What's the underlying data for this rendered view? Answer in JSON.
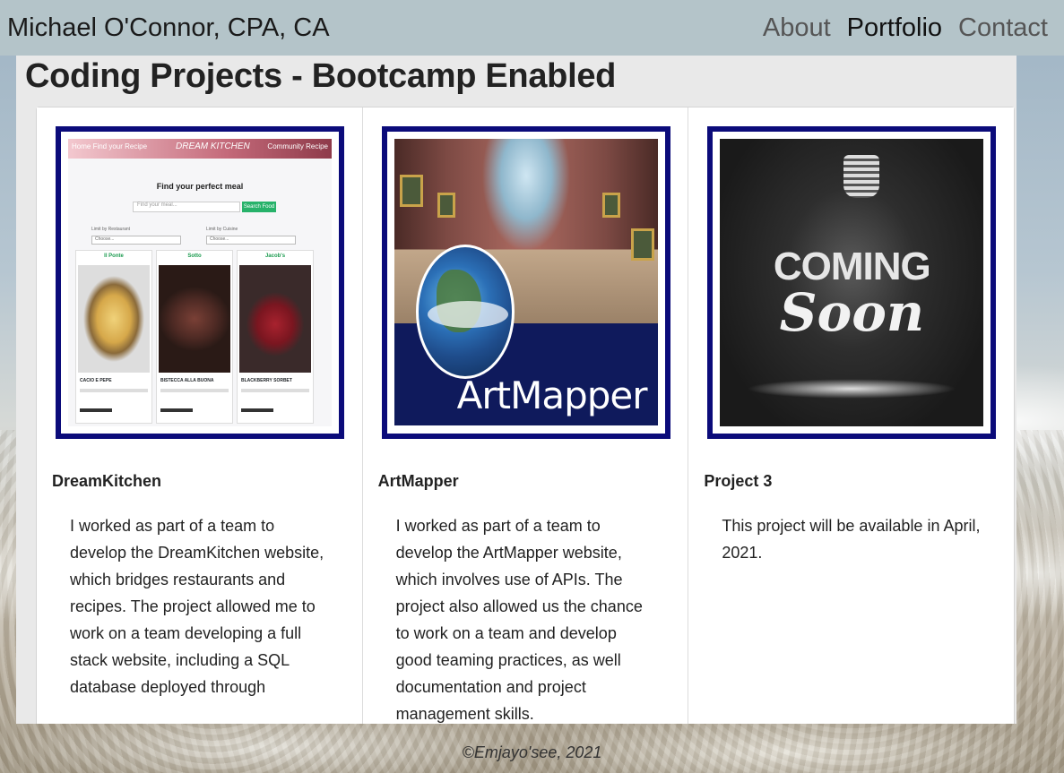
{
  "nav": {
    "brand": "Michael O'Connor, CPA, CA",
    "links": [
      {
        "label": "About",
        "active": false
      },
      {
        "label": "Portfolio",
        "active": true
      },
      {
        "label": "Contact",
        "active": false
      }
    ]
  },
  "page": {
    "title": "Coding Projects - Bootcamp Enabled"
  },
  "projects": [
    {
      "title": "DreamKitchen",
      "text": "I worked as part of a team to develop the DreamKitchen website, which bridges restaurants and recipes. The project allowed me to work on a team developing a full stack website, including a SQL database deployed through",
      "thumbnail": {
        "brand": "DREAM KITCHEN",
        "nav_left": "Home  Find your Recipe",
        "nav_right": "Community Recipe",
        "heading": "Find your perfect meal",
        "search_placeholder": "Find your meal...",
        "search_button": "Search Food",
        "filter_1_label": "Limit by Restaurant",
        "filter_2_label": "Limit by Cuisine",
        "filter_value": "Choose...",
        "restaurants": [
          "Il Ponte",
          "Sotto",
          "Jacob's"
        ],
        "dishes": [
          "CACIO E PEPE",
          "BISTECCA ALLA BUONA",
          "BLACKBERRY SORBET"
        ]
      }
    },
    {
      "title": "ArtMapper",
      "text": "I worked as part of a team to develop the ArtMapper website, which involves use of APIs. The project also allowed us the chance to work on a team and develop good teaming practices, as well documentation and project management skills.",
      "thumbnail": {
        "caption": "ArtMapper"
      }
    },
    {
      "title": "Project 3",
      "text": "This project will be available in April, 2021.",
      "thumbnail": {
        "line1": "COMING",
        "line2": "Soon"
      }
    }
  ],
  "footer": {
    "text": "©Emjayo'see, 2021"
  },
  "colors": {
    "navbar": "#b4c4c9",
    "image_border": "#0b0b7a",
    "panel": "#e9e9e9"
  }
}
